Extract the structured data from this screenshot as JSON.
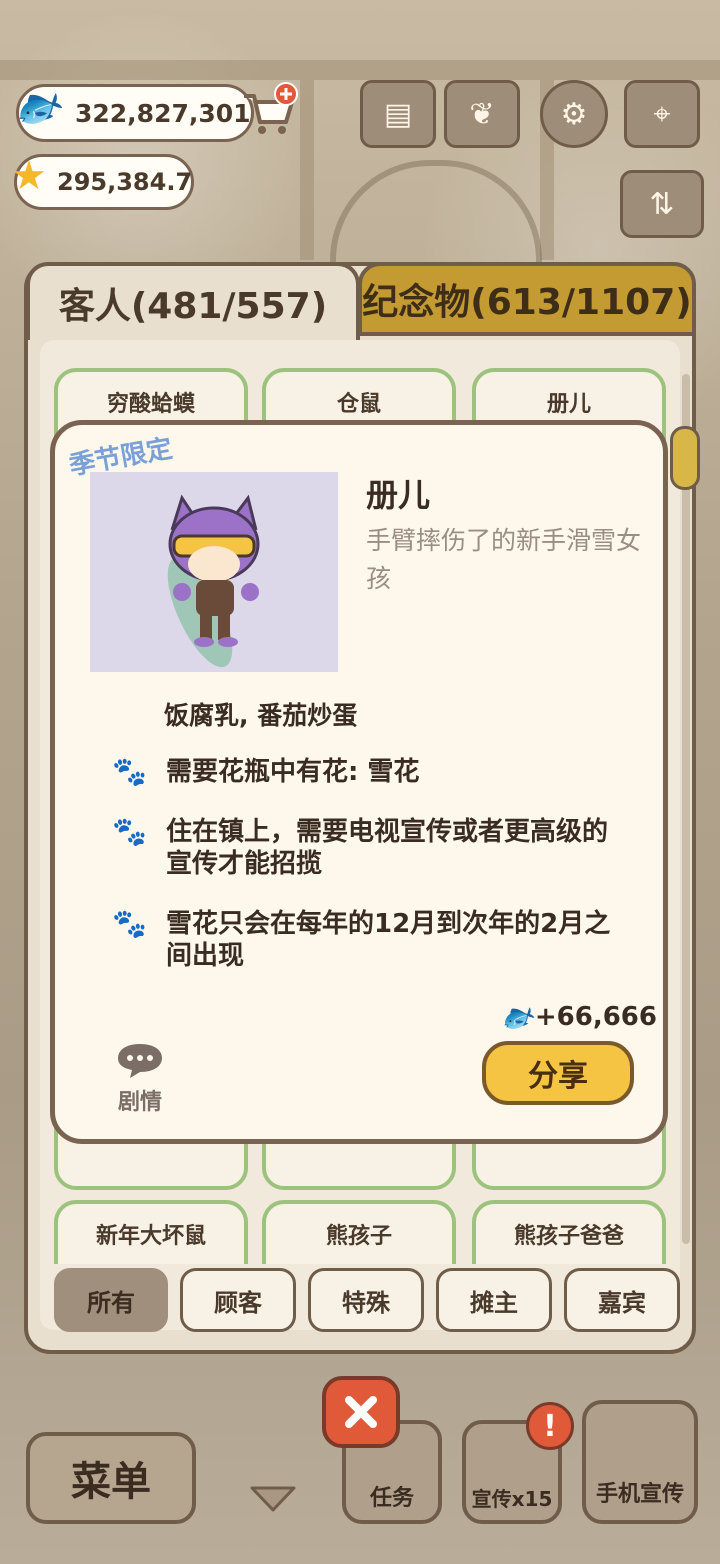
{
  "currency": {
    "fish": "322,827,301",
    "stars": "295,384.7"
  },
  "tabs": {
    "customers": "客人(481/557)",
    "souvenirs": "纪念物(613/1107)"
  },
  "grid": {
    "row1": [
      "穷酸蛤蟆",
      "仓鼠",
      "册儿"
    ],
    "row3": [
      "新年大坏鼠",
      "熊孩子",
      "熊孩子爸爸"
    ]
  },
  "detail": {
    "season_tag": "季节限定",
    "name": "册儿",
    "description": "手臂摔伤了的新手滑雪女孩",
    "favorite_food": "饭腐乳, 番茄炒蛋",
    "requirements": [
      "需要花瓶中有花: 雪花",
      "住在镇上，需要电视宣传或者更高级的宣传才能招揽",
      "雪花只会在每年的12月到次年的2月之间出现"
    ],
    "reward": "+66,666",
    "story_label": "剧情",
    "share_label": "分享"
  },
  "filters": [
    "所有",
    "顾客",
    "特殊",
    "摊主",
    "嘉宾"
  ],
  "bottom_bar": {
    "menu": "菜单",
    "tasks": "任务",
    "promote": "宣传x15",
    "phone_promote": "手机宣传"
  },
  "colors": {
    "accent_gold": "#f5c443",
    "card_border": "#9cc27e",
    "panel_border": "#6f5c49",
    "close_red": "#e05a3a"
  }
}
